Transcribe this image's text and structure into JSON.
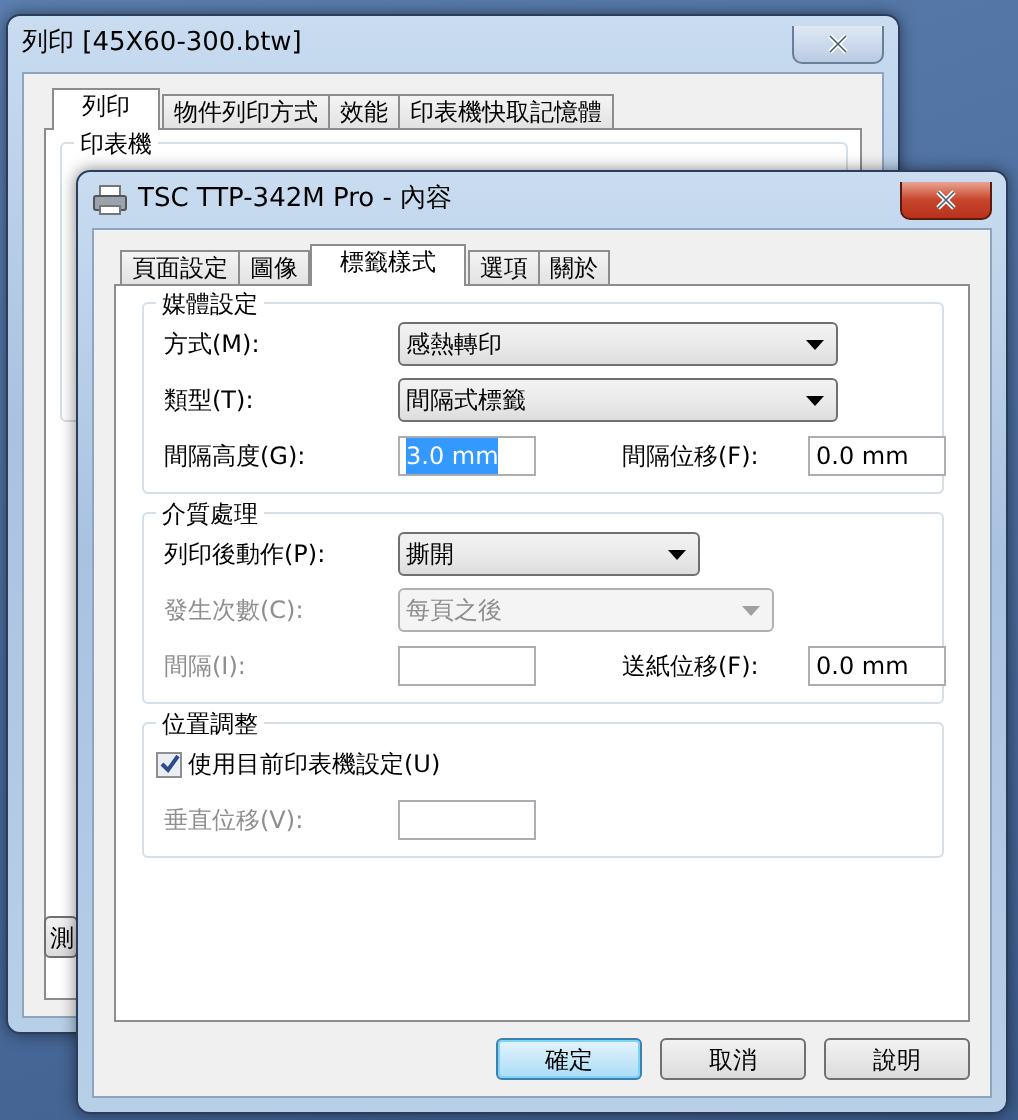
{
  "back_window": {
    "title": "列印 [45X60-300.btw]",
    "tabs": [
      {
        "label": "列印",
        "selected": true
      },
      {
        "label": "物件列印方式",
        "selected": false
      },
      {
        "label": "效能",
        "selected": false
      },
      {
        "label": "印表機快取記憶體",
        "selected": false
      }
    ],
    "group_title": "印表機",
    "button": "測"
  },
  "front_window": {
    "title": "TSC TTP-342M Pro - 內容",
    "tabs": [
      {
        "label": "頁面設定",
        "selected": false
      },
      {
        "label": "圖像",
        "selected": false
      },
      {
        "label": "標籤樣式",
        "selected": true
      },
      {
        "label": "選項",
        "selected": false
      },
      {
        "label": "關於",
        "selected": false
      }
    ],
    "groups": [
      {
        "title": "媒體設定",
        "rows": [
          {
            "fields": [
              {
                "kind": "select",
                "label": "方式(M):",
                "value": "感熱轉印",
                "disabled": false
              }
            ]
          },
          {
            "fields": [
              {
                "kind": "select",
                "label": "類型(T):",
                "value": "間隔式標籤",
                "disabled": false
              }
            ]
          },
          {
            "fields": [
              {
                "kind": "input",
                "label": "間隔高度(G):",
                "value": "3.0 mm",
                "disabled": false,
                "selected": true
              },
              {
                "kind": "input",
                "label": "間隔位移(F):",
                "value": "0.0 mm",
                "disabled": false,
                "selected": false
              }
            ]
          }
        ]
      },
      {
        "title": "介質處理",
        "rows": [
          {
            "fields": [
              {
                "kind": "select",
                "label": "列印後動作(P):",
                "value": "撕開",
                "disabled": false
              }
            ]
          },
          {
            "fields": [
              {
                "kind": "select",
                "label": "發生次數(C):",
                "value": "每頁之後",
                "disabled": true
              }
            ]
          },
          {
            "fields": [
              {
                "kind": "input",
                "label": "間隔(I):",
                "disabled": true
              },
              {
                "kind": "input",
                "label": "送紙位移(F):",
                "value": "0.0 mm",
                "disabled": false,
                "selected": false
              }
            ]
          }
        ]
      },
      {
        "title": "位置調整",
        "rows": [
          {
            "fields": [
              {
                "kind": "checkbox",
                "label": "使用目前印表機設定(U)",
                "checked": true,
                "disabled": false
              }
            ]
          },
          {
            "fields": [
              {
                "kind": "input",
                "label": "垂直位移(V):",
                "disabled": true
              }
            ]
          }
        ]
      }
    ],
    "buttons": [
      {
        "label": "確定",
        "default": true
      },
      {
        "label": "取消",
        "default": false
      },
      {
        "label": "說明",
        "default": false
      }
    ]
  }
}
